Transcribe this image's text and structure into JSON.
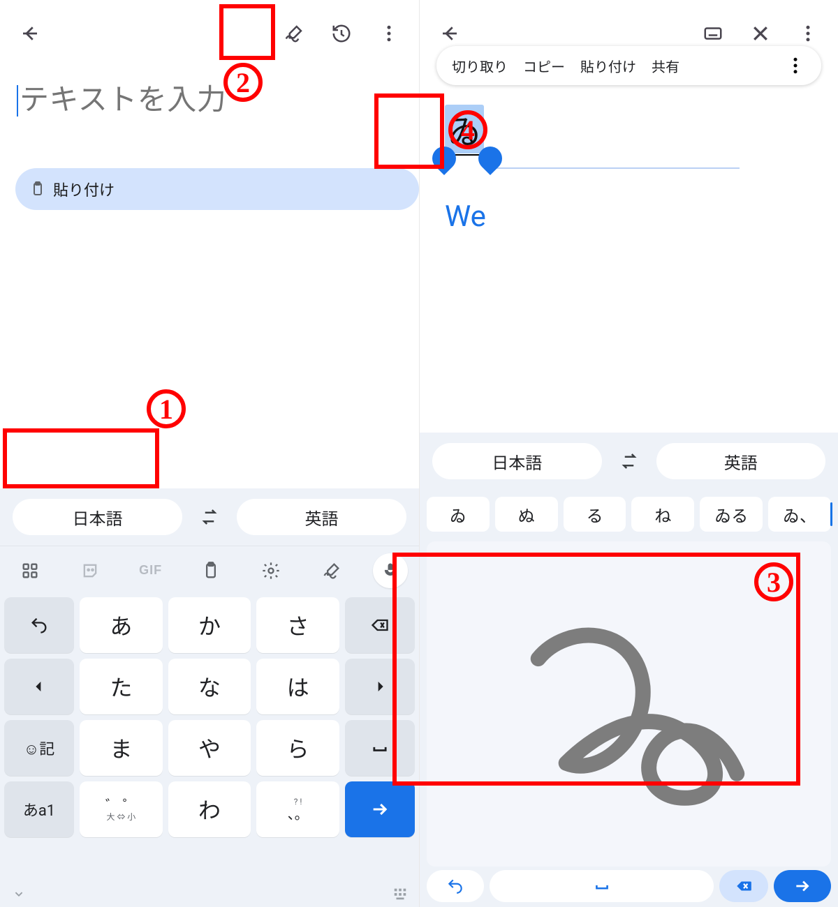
{
  "left": {
    "appbar": {
      "back_icon": "back-arrow-icon",
      "hand_icon": "handwriting-edit-icon",
      "history_icon": "history-icon",
      "more_icon": "more-vert-icon"
    },
    "placeholder": "テキストを入力",
    "paste_chip": {
      "icon": "clipboard-icon",
      "label": "貼り付け"
    },
    "langbar": {
      "left": "日本語",
      "swap_icon": "swap-icon",
      "right": "英語"
    },
    "toolbar": {
      "apps_icon": "apps-grid-icon",
      "sticker_icon": "sticker-icon",
      "gif": "GIF",
      "clipboard_icon": "clipboard-icon",
      "settings_icon": "gear-icon",
      "hand_icon": "handwriting-edit-icon",
      "mic_icon": "mic-icon"
    },
    "keys": {
      "undo_icon": "undo-icon",
      "a": "あ",
      "ka": "か",
      "sa": "さ",
      "backspace_icon": "backspace-icon",
      "left_icon": "caret-left-icon",
      "ta": "た",
      "na": "な",
      "ha": "は",
      "right_icon": "caret-right-icon",
      "sym_key": "☺記",
      "ma": "ま",
      "ya": "や",
      "ra": "ら",
      "space_icon": "space-bar-icon",
      "mode_key": "あa1",
      "dakuten_main": "゛  ゜",
      "dakuten_sub": "大 ⇔ 小",
      "wa": "わ",
      "punct_main": "、。",
      "punct_sub": " ?  !",
      "enter_icon": "arrow-right-icon"
    },
    "kbfoot": {
      "collapse_icon": "chevron-down-icon",
      "keyboard_icon": "keyboard-grid-icon"
    }
  },
  "right": {
    "appbar": {
      "back_icon": "back-arrow-icon",
      "keyboard_icon": "keyboard-icon",
      "close_icon": "close-icon",
      "more_icon": "more-vert-icon"
    },
    "context_menu": {
      "cut": "切り取り",
      "copy": "コピー",
      "paste": "貼り付け",
      "share": "共有",
      "more_icon": "more-vert-icon"
    },
    "selected_text": "ゐ",
    "suggestion": "We",
    "langbar": {
      "left": "日本語",
      "swap_icon": "swap-icon",
      "right": "英語"
    },
    "candidates": [
      "ゐ",
      "ぬ",
      "る",
      "ね",
      "ゐる",
      "ゐ、"
    ],
    "hwfoot": {
      "undo_icon": "undo-icon",
      "space_icon": "space-bar-icon",
      "backspace_icon": "backspace-filled-icon",
      "go_icon": "arrow-right-icon"
    }
  },
  "annotations": {
    "1": "1",
    "2": "2",
    "3": "3",
    "4": "4"
  }
}
